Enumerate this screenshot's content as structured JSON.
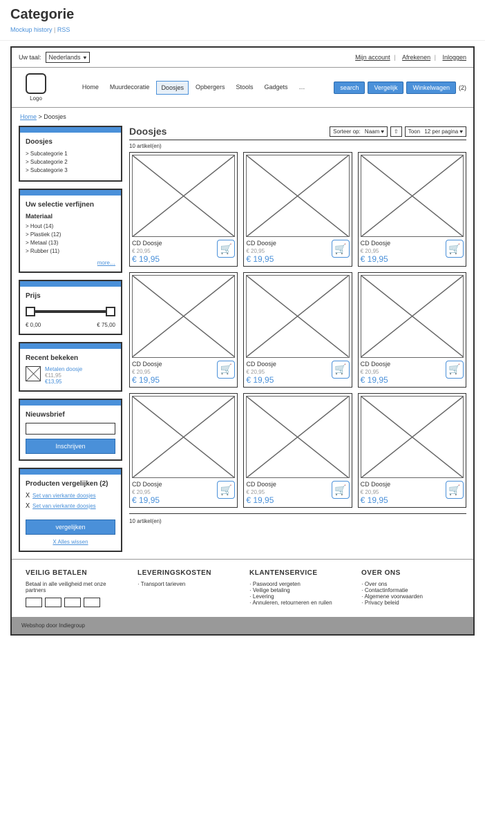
{
  "page": {
    "title": "Categorie",
    "mockup_link": "Mockup history",
    "rss_link": "RSS"
  },
  "topbar": {
    "lang_label": "Uw taal:",
    "lang_value": "Nederlands",
    "account": "Mijn account",
    "checkout": "Afrekenen",
    "login": "Inloggen"
  },
  "header": {
    "logo_label": "Logo",
    "nav": [
      "Home",
      "Muurdecoratie",
      "Doosjes",
      "Opbergers",
      "Stools",
      "Gadgets",
      "…"
    ],
    "nav_active": 2,
    "search_btn": "search",
    "compare_btn": "Vergelijk",
    "cart_btn": "Winkelwagen",
    "cart_count": "(2)"
  },
  "breadcrumb": {
    "home": "Home",
    "current": "Doosjes"
  },
  "sidebar": {
    "categories": {
      "title": "Doosjes",
      "items": [
        "> Subcategorie 1",
        "> Subcategorie 2",
        "> Subcategorie 3"
      ]
    },
    "filter": {
      "title": "Uw selectie verfijnen",
      "group": "Materiaal",
      "items": [
        "> Hout (14)",
        "> Plastiek (12)",
        "> Metaal (13)",
        "> Rubber (11)"
      ],
      "more": "more…"
    },
    "price": {
      "title": "Prijs",
      "min": "€ 0,00",
      "max": "€ 75,00"
    },
    "recent": {
      "title": "Recent bekeken",
      "name": "Metalen doosje",
      "old": "€11,95",
      "new": "€13,95"
    },
    "newsletter": {
      "title": "Nieuwsbrief",
      "placeholder": "",
      "subscribe": "Inschrijven"
    },
    "compare": {
      "title": "Producten vergelijken (2)",
      "items": [
        "Set van vierkante doosjes",
        "Set van vierkante doosjes"
      ],
      "btn": "vergelijken",
      "clear": "X Alles wissen"
    }
  },
  "main": {
    "title": "Doosjes",
    "sort_label": "Sorteer op:",
    "sort_value": "Naam",
    "show_label": "Toon",
    "show_value": "12 per pagina",
    "count": "10 artikel(en)",
    "products": [
      {
        "name": "CD Doosje",
        "old": "€ 20,95",
        "price": "€ 19,95"
      },
      {
        "name": "CD Doosje",
        "old": "€ 20,95",
        "price": "€ 19,95"
      },
      {
        "name": "CD Doosje",
        "old": "€ 20,95",
        "price": "€ 19,95"
      },
      {
        "name": "CD Doosje",
        "old": "€ 20,95",
        "price": "€ 19,95"
      },
      {
        "name": "CD Doosje",
        "old": "€ 20,95",
        "price": "€ 19,95"
      },
      {
        "name": "CD Doosje",
        "old": "€ 20,95",
        "price": "€ 19,95"
      },
      {
        "name": "CD Doosje",
        "old": "€ 20,95",
        "price": "€ 19,95"
      },
      {
        "name": "CD Doosje",
        "old": "€ 20,95",
        "price": "€ 19,95"
      },
      {
        "name": "CD Doosje",
        "old": "€ 20,95",
        "price": "€ 19,95"
      }
    ]
  },
  "footer": {
    "col1": {
      "title": "VEILIG BETALEN",
      "text": "Betaal in alle veiligheid met onze partners"
    },
    "col2": {
      "title": "LEVERINGSKOSTEN",
      "items": [
        "Transport tarieven"
      ]
    },
    "col3": {
      "title": "KLANTENSERVICE",
      "items": [
        "Paswoord vergeten",
        "Veilige betaling",
        "Levering",
        "Annuleren, retourneren en ruilen"
      ]
    },
    "col4": {
      "title": "OVER ONS",
      "items": [
        "Over ons",
        "Contactinformatie",
        "Algemene voorwaarden",
        "Privacy beleid"
      ]
    },
    "bottom": "Webshop door Indiegroup"
  }
}
